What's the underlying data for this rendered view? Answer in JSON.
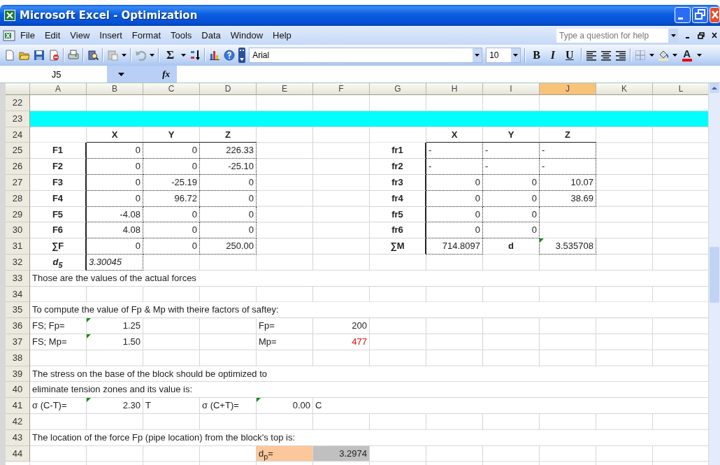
{
  "window": {
    "title": "Microsoft Excel - Optimization"
  },
  "menu": [
    "File",
    "Edit",
    "View",
    "Insert",
    "Format",
    "Tools",
    "Data",
    "Window",
    "Help"
  ],
  "help_box": {
    "placeholder": "Type a question for help"
  },
  "toolbar": {
    "autosum": "Σ",
    "font": "Arial",
    "size": "10",
    "format_buttons": [
      "B",
      "I",
      "U"
    ],
    "font_color": "A"
  },
  "formula_bar": {
    "name_box": "J5",
    "function_label": "fx"
  },
  "columns": [
    {
      "label": "A",
      "selected": false
    },
    {
      "label": "B",
      "selected": false
    },
    {
      "label": "C",
      "selected": false
    },
    {
      "label": "D",
      "selected": false
    },
    {
      "label": "E",
      "selected": false
    },
    {
      "label": "F",
      "selected": false
    },
    {
      "label": "G",
      "selected": false
    },
    {
      "label": "H",
      "selected": false
    },
    {
      "label": "I",
      "selected": false
    },
    {
      "label": "J",
      "selected": true
    },
    {
      "label": "K",
      "selected": false
    },
    {
      "label": "L",
      "selected": false
    }
  ],
  "rows": [
    {
      "number": "22",
      "kind": "plain",
      "cells": []
    },
    {
      "number": "23",
      "kind": "band",
      "cells": []
    },
    {
      "number": "24",
      "kind": "plain",
      "cells": [
        {
          "kind": "empty",
          "flag": false
        },
        {
          "text": "X",
          "kind": "head",
          "flag": false
        },
        {
          "text": "Y",
          "kind": "head",
          "flag": false
        },
        {
          "text": "Z",
          "kind": "head",
          "flag": false
        },
        {
          "kind": "empty",
          "flag": false
        },
        {
          "kind": "empty",
          "flag": false
        },
        {
          "kind": "empty",
          "flag": false
        },
        {
          "text": "X",
          "kind": "head",
          "flag": false
        },
        {
          "text": "Y",
          "kind": "head",
          "flag": false
        },
        {
          "text": "Z",
          "kind": "head",
          "flag": false
        }
      ]
    },
    {
      "number": "25",
      "kind": "plain",
      "cells": [
        {
          "text": "F1",
          "kind": "label",
          "flag": false
        },
        {
          "text": "0",
          "kind": "value",
          "flag": false
        },
        {
          "text": "0",
          "kind": "value",
          "flag": false
        },
        {
          "text": "226.33",
          "kind": "value",
          "flag": false
        },
        {
          "kind": "empty",
          "flag": false
        },
        {
          "kind": "empty",
          "flag": false
        },
        {
          "text": "fr1",
          "kind": "label",
          "flag": false
        },
        {
          "text": "-",
          "kind": "dash",
          "flag": false
        },
        {
          "text": "-",
          "kind": "dash",
          "flag": false
        },
        {
          "text": "-",
          "kind": "dash",
          "flag": false
        }
      ]
    },
    {
      "number": "26",
      "kind": "plain",
      "cells": [
        {
          "text": "F2",
          "kind": "label",
          "flag": false
        },
        {
          "text": "0",
          "kind": "value",
          "flag": false
        },
        {
          "text": "0",
          "kind": "value",
          "flag": false
        },
        {
          "text": "-25.10",
          "kind": "value",
          "flag": false
        },
        {
          "kind": "empty",
          "flag": false
        },
        {
          "kind": "empty",
          "flag": false
        },
        {
          "text": "fr2",
          "kind": "label",
          "flag": false
        },
        {
          "text": "-",
          "kind": "dash",
          "flag": false
        },
        {
          "text": "-",
          "kind": "dash",
          "flag": false
        },
        {
          "text": "-",
          "kind": "dash",
          "flag": false
        }
      ]
    },
    {
      "number": "27",
      "kind": "plain",
      "cells": [
        {
          "text": "F3",
          "kind": "label",
          "flag": false
        },
        {
          "text": "0",
          "kind": "value",
          "flag": false
        },
        {
          "text": "-25.19",
          "kind": "value",
          "flag": false
        },
        {
          "text": "0",
          "kind": "value",
          "flag": false
        },
        {
          "kind": "empty",
          "flag": false
        },
        {
          "kind": "empty",
          "flag": false
        },
        {
          "text": "fr3",
          "kind": "label",
          "flag": false
        },
        {
          "text": "0",
          "kind": "value",
          "flag": false
        },
        {
          "text": "0",
          "kind": "value",
          "flag": false
        },
        {
          "text": "10.07",
          "kind": "value",
          "flag": false
        }
      ]
    },
    {
      "number": "28",
      "kind": "plain",
      "cells": [
        {
          "text": "F4",
          "kind": "label",
          "flag": false
        },
        {
          "text": "0",
          "kind": "value",
          "flag": false
        },
        {
          "text": "96.72",
          "kind": "value",
          "flag": false
        },
        {
          "text": "0",
          "kind": "value",
          "flag": false
        },
        {
          "kind": "empty",
          "flag": false
        },
        {
          "kind": "empty",
          "flag": false
        },
        {
          "text": "fr4",
          "kind": "label",
          "flag": false
        },
        {
          "text": "0",
          "kind": "value",
          "flag": false
        },
        {
          "text": "0",
          "kind": "value",
          "flag": false
        },
        {
          "text": "38.69",
          "kind": "value",
          "flag": false
        }
      ]
    },
    {
      "number": "29",
      "kind": "plain",
      "cells": [
        {
          "text": "F5",
          "kind": "label",
          "flag": false
        },
        {
          "text": "-4.08",
          "kind": "value",
          "flag": false
        },
        {
          "text": "0",
          "kind": "value",
          "flag": false
        },
        {
          "text": "0",
          "kind": "value",
          "flag": false
        },
        {
          "kind": "empty",
          "flag": false
        },
        {
          "kind": "empty",
          "flag": false
        },
        {
          "text": "fr5",
          "kind": "label",
          "flag": false
        },
        {
          "text": "0",
          "kind": "value",
          "flag": false
        },
        {
          "text": "0",
          "kind": "value",
          "flag": false
        }
      ]
    },
    {
      "number": "30",
      "kind": "plain",
      "cells": [
        {
          "text": "F6",
          "kind": "label",
          "flag": false
        },
        {
          "text": "4.08",
          "kind": "value",
          "flag": false
        },
        {
          "text": "0",
          "kind": "value",
          "flag": false
        },
        {
          "text": "0",
          "kind": "value",
          "flag": false
        },
        {
          "kind": "empty",
          "flag": false
        },
        {
          "kind": "empty",
          "flag": false
        },
        {
          "text": "fr6",
          "kind": "label",
          "flag": false
        },
        {
          "text": "0",
          "kind": "value",
          "flag": false
        },
        {
          "text": "0",
          "kind": "value",
          "flag": false
        }
      ]
    },
    {
      "number": "31",
      "kind": "plain",
      "cells": [
        {
          "text": "∑F",
          "kind": "label",
          "flag": false
        },
        {
          "text": "0",
          "kind": "value",
          "flag": false
        },
        {
          "text": "0",
          "kind": "value",
          "flag": false
        },
        {
          "text": "250.00",
          "kind": "value",
          "flag": false
        },
        {
          "kind": "empty",
          "flag": false
        },
        {
          "kind": "empty",
          "flag": false
        },
        {
          "text": "∑M",
          "kind": "label",
          "flag": false
        },
        {
          "text": "714.8097",
          "kind": "value",
          "flag": false
        },
        {
          "text": "d",
          "kind": "key",
          "flag": false
        },
        {
          "text": "3.535708",
          "kind": "value",
          "flag": true
        }
      ]
    },
    {
      "number": "32",
      "kind": "plain",
      "cells": [
        {
          "text": "d$_{5}$",
          "kind": "symbol",
          "flag": false
        },
        {
          "text": "3.30045",
          "kind": "estimate",
          "flag": false
        }
      ]
    },
    {
      "number": "33",
      "kind": "plain",
      "cells": [
        {
          "text": "Those are the values of the actual forces",
          "kind": "text",
          "flag": false
        }
      ]
    },
    {
      "number": "34",
      "kind": "plain",
      "cells": []
    },
    {
      "number": "35",
      "kind": "plain",
      "cells": [
        {
          "text": "To compute the value of Fp & Mp with theire factors of saftey:",
          "kind": "text",
          "flag": false
        }
      ]
    },
    {
      "number": "36",
      "kind": "plain",
      "cells": [
        {
          "text": "FS; Fp=",
          "kind": "text",
          "flag": false
        },
        {
          "text": "1.25",
          "kind": "num",
          "flag": true
        },
        {
          "kind": "empty",
          "flag": false
        },
        {
          "kind": "empty",
          "flag": false
        },
        {
          "text": "Fp=",
          "kind": "text",
          "flag": false
        },
        {
          "text": "200",
          "kind": "num",
          "flag": false
        }
      ]
    },
    {
      "number": "37",
      "kind": "plain",
      "cells": [
        {
          "text": "FS; Mp=",
          "kind": "text",
          "flag": false
        },
        {
          "text": "1.50",
          "kind": "num",
          "flag": true
        },
        {
          "kind": "empty",
          "flag": false
        },
        {
          "kind": "empty",
          "flag": false
        },
        {
          "text": "Mp=",
          "kind": "text",
          "flag": false
        },
        {
          "text": "477",
          "kind": "alert",
          "flag": false
        }
      ]
    },
    {
      "number": "38",
      "kind": "plain",
      "cells": []
    },
    {
      "number": "39",
      "kind": "plain",
      "cells": [
        {
          "text": "The stress on the base of the block should be optimized to",
          "kind": "text",
          "flag": false
        }
      ]
    },
    {
      "number": "40",
      "kind": "plain",
      "cells": [
        {
          "text": "eliminate tension zones and its value is:",
          "kind": "text",
          "flag": false
        }
      ]
    },
    {
      "number": "41",
      "kind": "plain",
      "cells": [
        {
          "text": "σ (C-T)=",
          "kind": "text",
          "flag": false
        },
        {
          "text": "2.30",
          "kind": "num",
          "flag": true
        },
        {
          "text": "T",
          "kind": "text",
          "flag": false
        },
        {
          "text": "σ (C+T)=",
          "kind": "text",
          "flag": false
        },
        {
          "text": "0.00",
          "kind": "num",
          "flag": true
        },
        {
          "text": "C",
          "kind": "text",
          "flag": false
        }
      ]
    },
    {
      "number": "42",
      "kind": "plain",
      "cells": []
    },
    {
      "number": "43",
      "kind": "plain",
      "cells": [
        {
          "text": "The location of the force Fp (pipe location) from the block's top is:",
          "kind": "text",
          "flag": false
        }
      ]
    },
    {
      "number": "44",
      "kind": "plain",
      "cells": [
        {
          "kind": "empty",
          "flag": false
        },
        {
          "kind": "empty",
          "flag": false
        },
        {
          "kind": "empty",
          "flag": false
        },
        {
          "kind": "empty",
          "flag": false
        },
        {
          "text": "d$_{p}$=",
          "kind": "highlight",
          "flag": false
        },
        {
          "text": "3.2974",
          "kind": "result",
          "flag": false
        }
      ]
    }
  ]
}
